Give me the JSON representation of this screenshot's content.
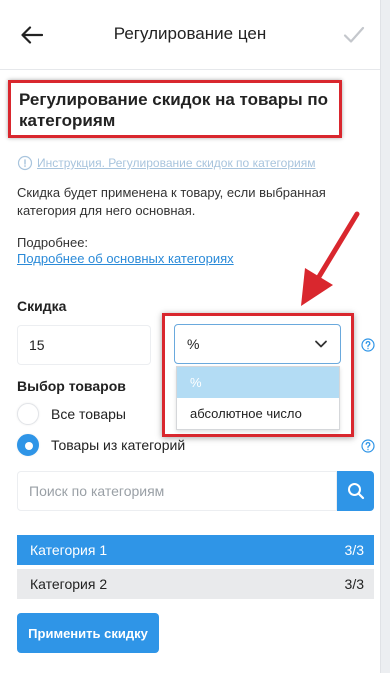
{
  "header": {
    "title": "Регулирование цен"
  },
  "section": {
    "title": "Регулирование скидок на товары по категориям",
    "instruction_link": "Инструкция. Регулирование скидок по категориям",
    "description": "Скидка будет применена к товару, если выбранная категория для него основная.",
    "more_label": "Подробнее:",
    "more_link": "Подробнее об основных категориях"
  },
  "discount": {
    "label": "Скидка",
    "value": "15",
    "unit_selected": "%",
    "unit_options": [
      "%",
      "абсолютное число"
    ]
  },
  "goods": {
    "label": "Выбор товаров",
    "options": [
      {
        "label": "Все товары",
        "selected": false
      },
      {
        "label": "Товары из категорий",
        "selected": true
      }
    ]
  },
  "search": {
    "placeholder": "Поиск по категориям"
  },
  "categories": [
    {
      "name": "Категория 1",
      "count": "3/3",
      "active": true
    },
    {
      "name": "Категория 2",
      "count": "3/3",
      "active": false
    }
  ],
  "actions": {
    "apply_label": "Применить скидку"
  },
  "colors": {
    "accent": "#2f95e7",
    "highlight_red": "#d9272e",
    "option_selected": "#b3dcf4"
  }
}
